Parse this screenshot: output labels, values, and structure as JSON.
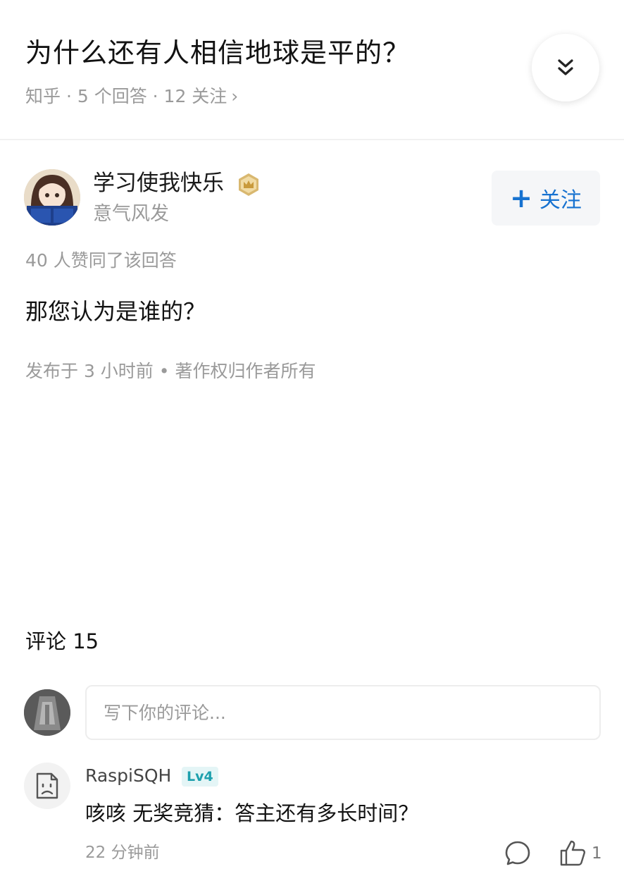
{
  "question": {
    "title": "为什么还有人相信地球是平的？",
    "meta": "知乎 · 5 个回答 · 12 关注",
    "meta_chevron": "›"
  },
  "author": {
    "name": "学习使我快乐",
    "bio": "意气风发",
    "follow_label": "关注",
    "follow_plus": "+"
  },
  "answer": {
    "votes": "40 人赞同了该回答",
    "text": "那您认为是谁的？",
    "publish_info": "发布于 3 小时前 • 著作权归作者所有"
  },
  "comments": {
    "title": "评论 15",
    "input_placeholder": "写下你的评论...",
    "items": [
      {
        "user": "RaspiSQH",
        "level": "Lv4",
        "text": "咳咳 无奖竞猜：答主还有多长时间？",
        "time": "22 分钟前",
        "likes": "1"
      }
    ]
  },
  "colors": {
    "accent": "#1772d0",
    "level_badge": "#1da0ad",
    "muted_text": "#9a9a9a"
  },
  "icons": {
    "collapse": "double-chevron-down-icon",
    "badge": "crown-badge-icon",
    "reply": "comment-bubble-icon",
    "like": "thumbs-up-icon",
    "default_avatar": "sad-face-avatar-icon"
  }
}
